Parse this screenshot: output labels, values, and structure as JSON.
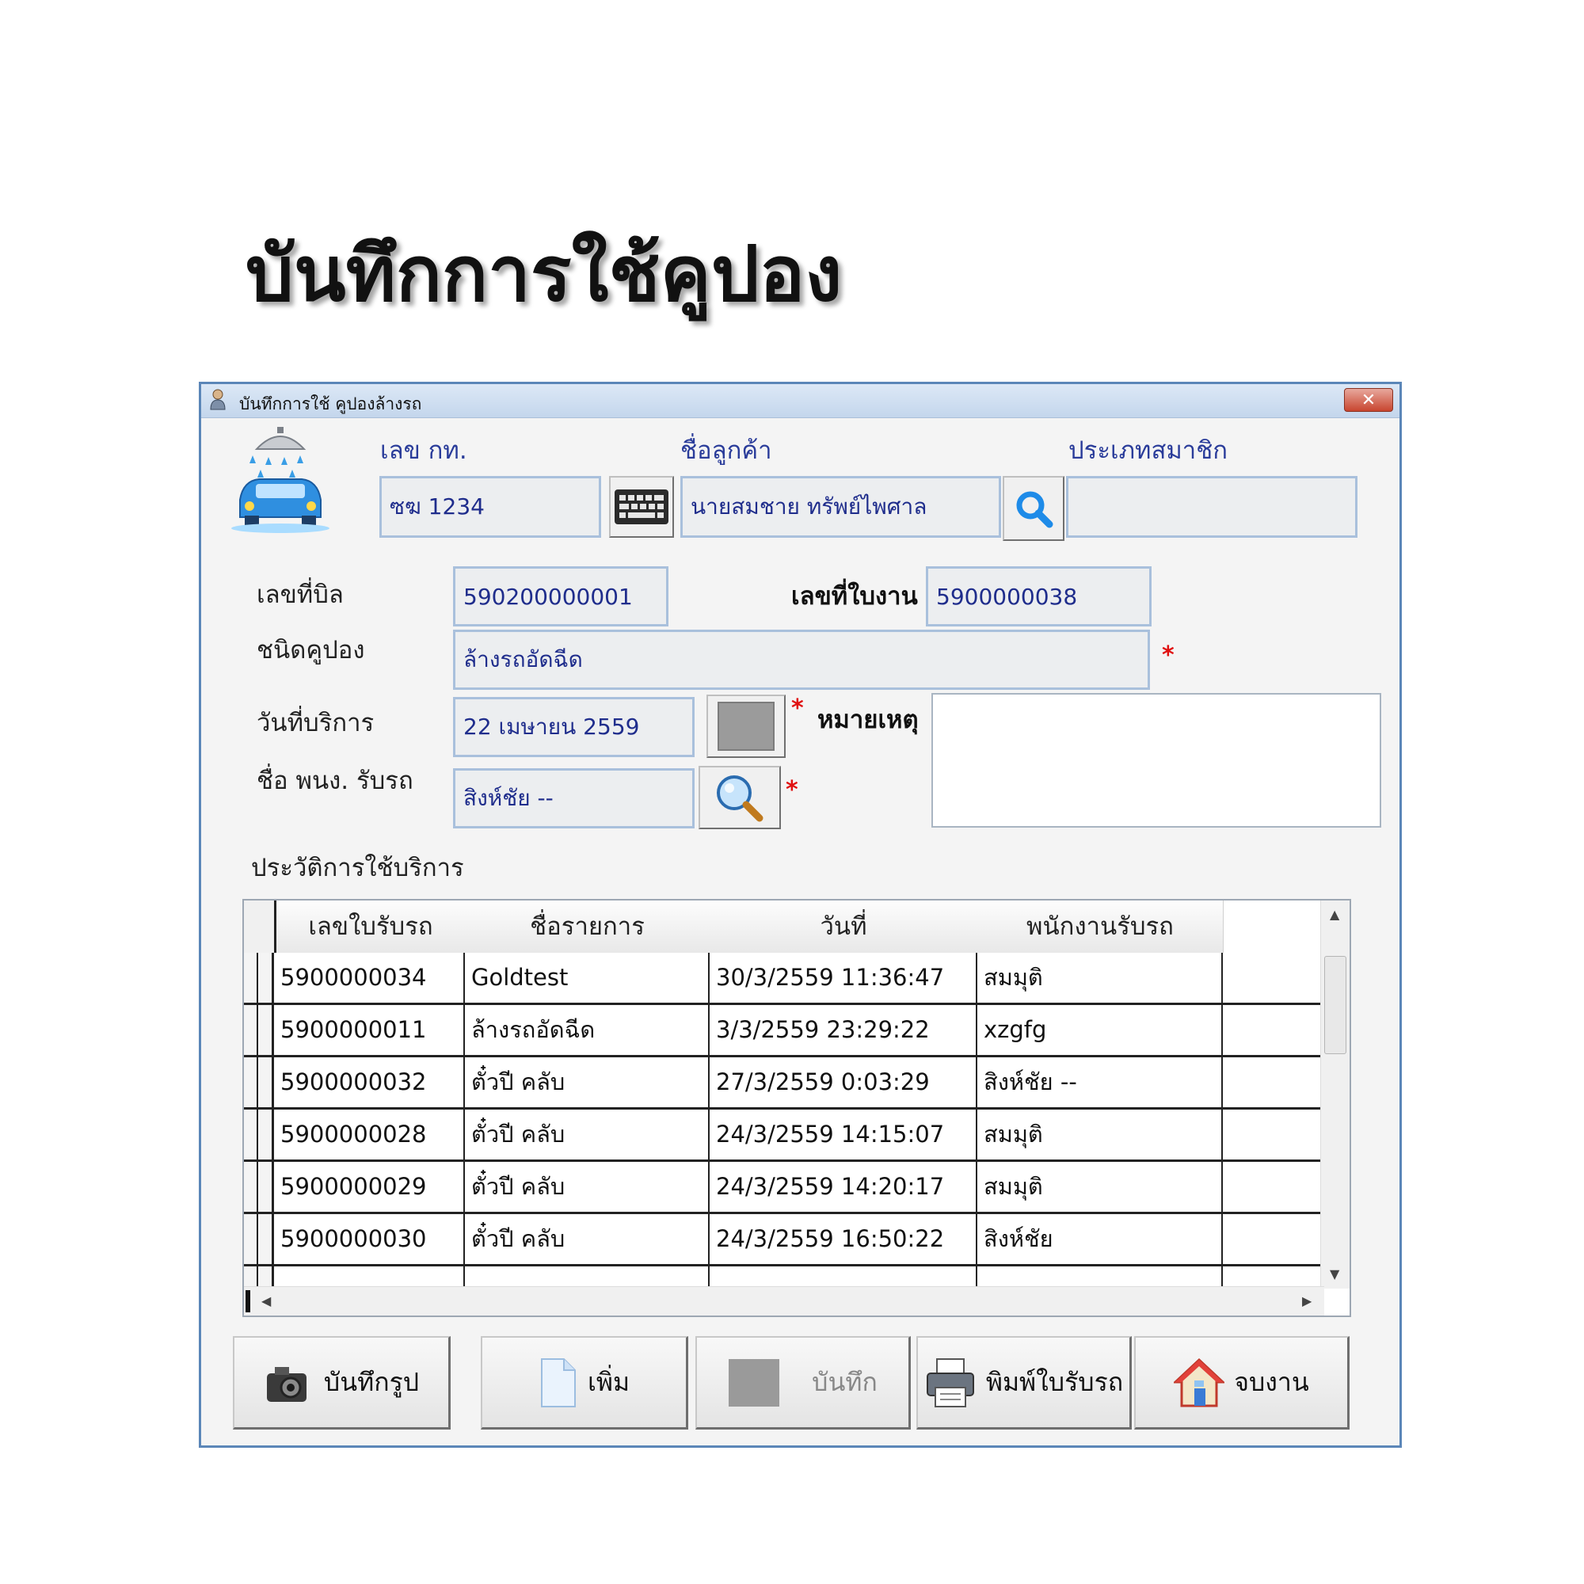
{
  "page_heading": "บันทึกการใช้คูปอง",
  "window": {
    "title": "บันทึกการใช้ คูปองล้างรถ",
    "close_label": "✕"
  },
  "fields": {
    "plate": {
      "label": "เลข  กท.",
      "value": "ซฆ  1234"
    },
    "customer": {
      "label": "ชื่อลูกค้า",
      "value": "นายสมชาย ทรัพย์ไพศาล"
    },
    "member_type": {
      "label": "ประเภทสมาชิก",
      "value": ""
    },
    "bill_no": {
      "label": "เลขที่บิล",
      "value": "590200000001"
    },
    "job_no": {
      "label": "เลขที่ใบงาน",
      "value": "5900000038"
    },
    "coupon_type": {
      "label": "ชนิดคูปอง",
      "value": "ล้างรถอัดฉีด"
    },
    "service_date": {
      "label": "วันที่บริการ",
      "value": "22 เมษายน 2559"
    },
    "receiver": {
      "label": "ชื่อ พนง. รับรถ",
      "value": "สิงห์ชัย --"
    },
    "remark": {
      "label": "หมายเหตุ",
      "value": ""
    }
  },
  "required_mark": "*",
  "history": {
    "title": "ประวัติการใช้บริการ",
    "columns": [
      "เลขใบรับรถ",
      "ชื่อรายการ",
      "วันที่",
      "พนักงานรับรถ"
    ],
    "rows": [
      [
        "5900000034",
        "Goldtest",
        "30/3/2559 11:36:47",
        "สมมุติ"
      ],
      [
        "5900000011",
        "ล้างรถอัดฉีด",
        "3/3/2559 23:29:22",
        "xzgfg"
      ],
      [
        "5900000032",
        "ตั๋วปี คลับ",
        "27/3/2559 0:03:29",
        "สิงห์ชัย --"
      ],
      [
        "5900000028",
        "ตั๋วปี คลับ",
        "24/3/2559 14:15:07",
        "สมมุติ"
      ],
      [
        "5900000029",
        "ตั๋วปี คลับ",
        "24/3/2559 14:20:17",
        "สมมุติ"
      ],
      [
        "5900000030",
        "ตั๋วปี คลับ",
        "24/3/2559 16:50:22",
        "สิงห์ชัย"
      ]
    ]
  },
  "buttons": {
    "save_photo": "บันทึกรูป",
    "add": "เพิ่ม",
    "save": "บันทึก",
    "print": "พิมพ์ใบรับรถ",
    "finish": "จบงาน"
  },
  "icons": {
    "keyboard": "keyboard-icon",
    "search_customer": "search-icon",
    "calendar": "calendar-icon",
    "search_staff": "magnifier-icon",
    "camera": "camera-icon",
    "document": "document-icon",
    "printer": "printer-icon",
    "home": "home-icon"
  },
  "colors": {
    "label_blue": "#2a3c9a",
    "required": "#e01010",
    "field_border": "#a9c0dc"
  }
}
